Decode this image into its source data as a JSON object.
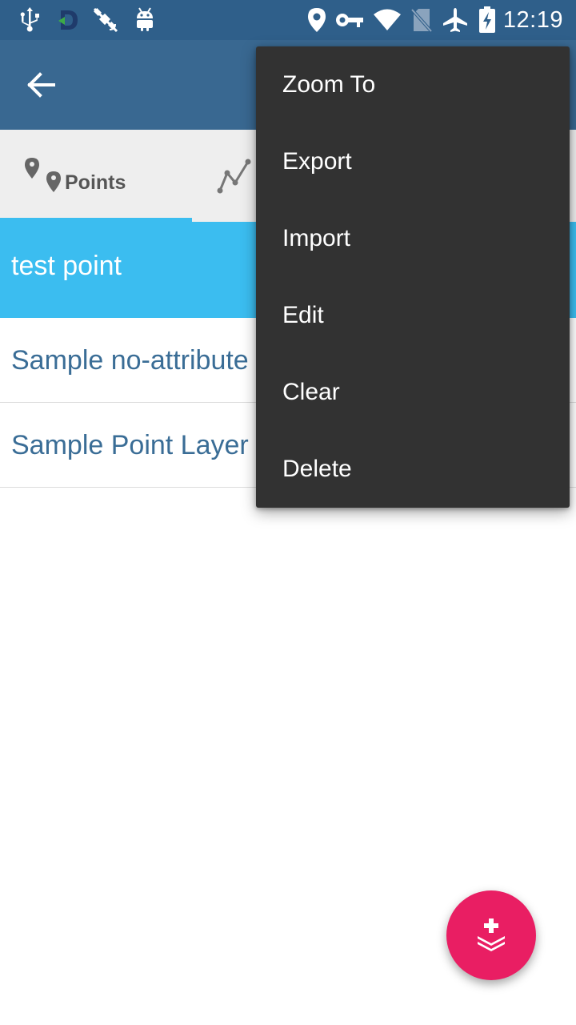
{
  "status_bar": {
    "time": "12:19",
    "icons_left": [
      "usb-icon",
      "app-d-icon",
      "gps-off-icon",
      "android-icon"
    ],
    "icons_right": [
      "location-icon",
      "vpn-key-icon",
      "wifi-icon",
      "no-sim-icon",
      "airplane-icon",
      "battery-charging-icon"
    ]
  },
  "app_bar": {
    "back_icon": "arrow-left-icon",
    "color": "#396891"
  },
  "tabs": {
    "items": [
      {
        "label": "Points",
        "icon": "points-icon",
        "selected": true
      },
      {
        "label": "",
        "icon": "lines-icon",
        "selected": false
      }
    ],
    "indicator_color": "#3bbdf0"
  },
  "list": {
    "selected_item": "test point",
    "items": [
      "Sample no-attribute",
      "Sample Point Layer"
    ],
    "selected_color": "#3bbdf0",
    "text_color": "#3a6d96"
  },
  "menu": {
    "items": [
      "Zoom To",
      "Export",
      "Import",
      "Edit",
      "Clear",
      "Delete"
    ]
  },
  "fab": {
    "icon": "add-layer-icon",
    "color": "#e91e63"
  }
}
